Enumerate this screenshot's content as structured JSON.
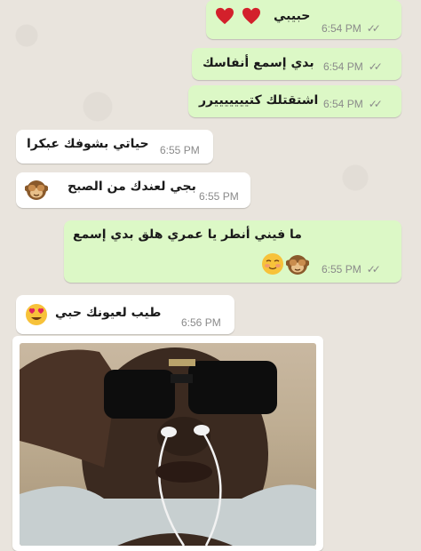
{
  "messages": [
    {
      "direction": "outgoing",
      "text": "حبيبي",
      "time": "6:54 PM",
      "status": "read",
      "emoji": [
        "heart",
        "heart"
      ]
    },
    {
      "direction": "outgoing",
      "text": "بدي إسمع أنفاسك",
      "time": "6:54 PM",
      "status": "read"
    },
    {
      "direction": "outgoing",
      "text": "اشتقتلك كتيييييييرر",
      "time": "6:54 PM",
      "status": "read"
    },
    {
      "direction": "incoming",
      "text": "حياتي بشوفك عبكرا",
      "time": "6:55 PM"
    },
    {
      "direction": "incoming",
      "text": "بجي لعندك من الصبح",
      "time": "6:55 PM",
      "emoji": [
        "see-no-evil-monkey"
      ]
    },
    {
      "direction": "outgoing",
      "text": "ما فيني أنطر يا عمري هلق بدي إسمع",
      "time": "6:55 PM",
      "status": "read",
      "emoji": [
        "smiling-blush",
        "see-no-evil-monkey"
      ]
    },
    {
      "direction": "incoming",
      "text": "طيب لعيونك حبي",
      "time": "6:56 PM",
      "emoji": [
        "heart-eyes"
      ]
    },
    {
      "direction": "incoming",
      "type": "photo",
      "description": ""
    }
  ],
  "ticks_glyph": "✓✓",
  "colors": {
    "outgoing_bubble": "#dcf8c6",
    "incoming_bubble": "#ffffff",
    "meta_text": "#8a8a8a"
  }
}
